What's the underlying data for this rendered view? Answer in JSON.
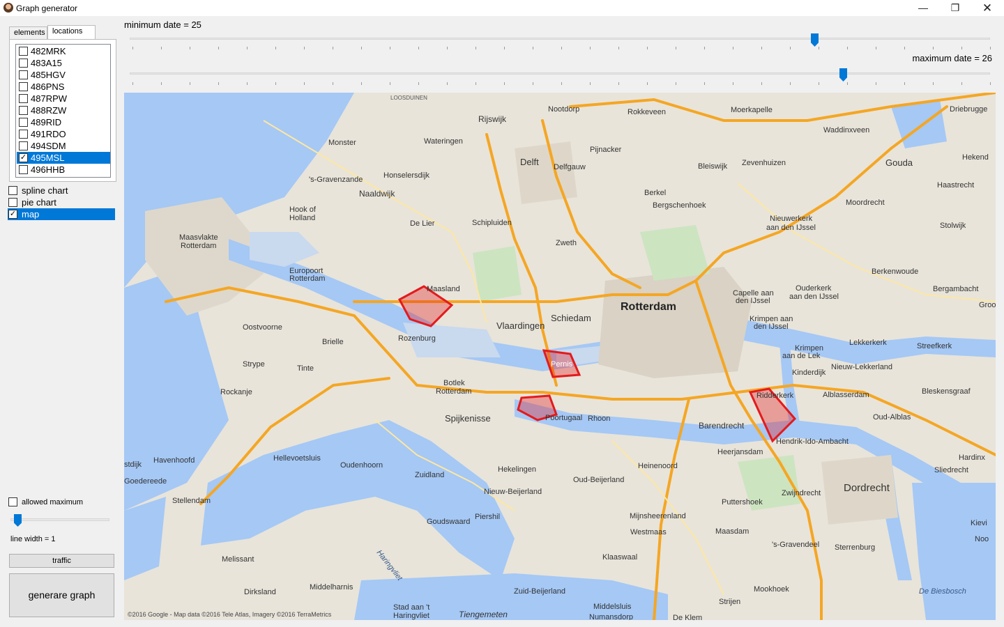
{
  "window": {
    "title": "Graph generator",
    "minimize": "—",
    "restore": "❐",
    "close": "✕"
  },
  "tabs": [
    {
      "label": "elements"
    },
    {
      "label": "locations"
    }
  ],
  "locations": [
    {
      "label": "482MRK",
      "checked": false
    },
    {
      "label": "483A15",
      "checked": false
    },
    {
      "label": "485HGV",
      "checked": false
    },
    {
      "label": "486PNS",
      "checked": false
    },
    {
      "label": "487RPW",
      "checked": false
    },
    {
      "label": "488RZW",
      "checked": false
    },
    {
      "label": "489RID",
      "checked": false
    },
    {
      "label": "491RDO",
      "checked": false
    },
    {
      "label": "494SDM",
      "checked": false
    },
    {
      "label": "495MSL",
      "checked": true,
      "selected": true
    },
    {
      "label": "496HHB",
      "checked": false
    }
  ],
  "chart_options": [
    {
      "label": "spline chart",
      "checked": false
    },
    {
      "label": "pie chart",
      "checked": false
    },
    {
      "label": "map",
      "checked": true,
      "selected": true
    }
  ],
  "allowed_maximum": {
    "label": "allowed maximum",
    "checked": false
  },
  "line_width": {
    "label": "line width = 1",
    "value": 1
  },
  "buttons": {
    "traffic": "traffic",
    "generate": "generare graph"
  },
  "sliders": {
    "minimum": {
      "label": "minimum date = 25",
      "value": 25
    },
    "maximum": {
      "label": "maximum date = 26",
      "value": 26
    }
  },
  "colors": {
    "accent": "#0078d7",
    "highway": "#f5a623",
    "water": "#a5c8f5",
    "polygon": "#e41a1c"
  },
  "map": {
    "copyright": "©2016 Google - Map data ©2016 Tele Atlas, Imagery ©2016 TerraMetrics",
    "places": [
      "Rotterdam",
      "Schiedam",
      "Vlaardingen",
      "Maasland",
      "Delft",
      "Rijswijk",
      "Naaldwijk",
      "Monster",
      "Wateringen",
      "Honselersdijk",
      "'s-Gravenzande",
      "Hook of Holland",
      "De Lier",
      "Schipluiden",
      "Nootdorp",
      "Pijnacker",
      "Delfgauw",
      "Berkel",
      "Bergschenhoek",
      "Rokkeveen",
      "Zevenhuizen",
      "Bleiswijk",
      "Moerkapelle",
      "Waddinxveen",
      "Gouda",
      "Driebrugge",
      "Hekendorp",
      "Haastrecht",
      "Moordrecht",
      "Stolwijk",
      "Nieuwerkerk aan den IJssel",
      "Capelle aan den IJssel",
      "Ouderkerk aan den IJssel",
      "Krimpen aan den IJssel",
      "Berkenwoude",
      "Bergambacht",
      "Lekkerkerk",
      "Streefkerk",
      "Krimpen aan de Lek",
      "Nieuw-Lekkerland",
      "Kinderdijk",
      "Alblasserdam",
      "Bleskensgraaf",
      "Oud-Alblas",
      "Ridderkerk",
      "Hendrik-Ido-Ambacht",
      "Barendrecht",
      "Heerjansdam",
      "Zwijndrecht",
      "Dordrecht",
      "Sliedrecht",
      "Hardinxveld",
      "Pernis",
      "Rhoon",
      "Poortugaal",
      "Spijkenisse",
      "Botlek Rotterdam",
      "Rozenburg",
      "Brielle",
      "Oostvoorne",
      "Europoort Rotterdam",
      "Maasvlakte Rotterdam",
      "Rockanje",
      "Stryp",
      "Tinte",
      "Hellevoetsluis",
      "Oudenhoorn",
      "Zuidland",
      "Hekelingen",
      "Nieuw-Beijerland",
      "Oud-Beijerland",
      "Heinenoord",
      "Puttershoek",
      "Mijnsheerenland",
      "Westmaas",
      "Maasdam",
      "'s-Gravendeel",
      "Sterrenburg",
      "Klaaswaal",
      "Goudswaard",
      "Piershil",
      "Zuid-Beijerland",
      "Mookhoek",
      "Strijen",
      "Middelsluis",
      "Numansdorp",
      "De Klem",
      "Middelharnis",
      "Dirksland",
      "Melissant",
      "Stellendam",
      "Havenhoofd",
      "Goedereede",
      "Stad aan 't Haringvliet",
      "Tiengemeten",
      "Haringvliet",
      "De Biesbosch",
      "Zweth",
      "Ostdijk",
      "Loosduinen",
      "Kievit",
      "Groo",
      "Noo"
    ]
  }
}
